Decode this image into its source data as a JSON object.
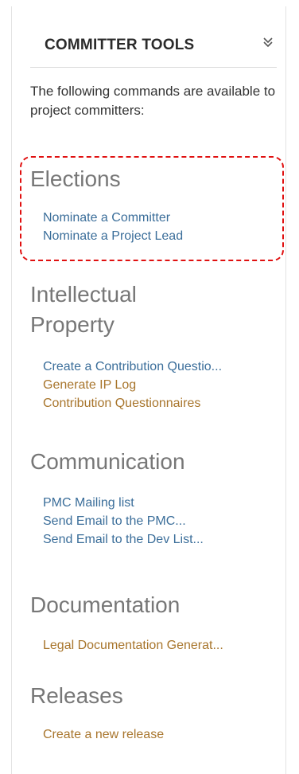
{
  "header": {
    "title": "COMMITTER TOOLS",
    "collapse_icon": "double-chevron-down-icon"
  },
  "intro": {
    "text": "The following commands are available to project committers:"
  },
  "sections": [
    {
      "title": "Elections",
      "links": [
        {
          "label": "Nominate a Committer",
          "color": "#3b6e9a"
        },
        {
          "label": "Nominate a Project Lead",
          "color": "#3b6e9a"
        }
      ]
    },
    {
      "title_lines": [
        "Intellectual",
        "Property"
      ],
      "links": [
        {
          "label": "Create a Contribution Questio...",
          "color": "#3b6e9a"
        },
        {
          "label": "Generate IP Log",
          "color": "#a8752c"
        },
        {
          "label": "Contribution Questionnaires",
          "color": "#a8752c"
        }
      ]
    },
    {
      "title": "Communication",
      "links": [
        {
          "label": "PMC Mailing list",
          "color": "#3b6e9a"
        },
        {
          "label": "Send Email to the PMC...",
          "color": "#3b6e9a"
        },
        {
          "label": "Send Email to the Dev List...",
          "color": "#3b6e9a"
        }
      ]
    },
    {
      "title": "Documentation",
      "links": [
        {
          "label": "Legal Documentation Generat...",
          "color": "#a8752c"
        }
      ]
    },
    {
      "title": "Releases",
      "links": [
        {
          "label": "Create a new release",
          "color": "#a8752c"
        }
      ]
    }
  ],
  "colors": {
    "link_blue": "#3b6e9a",
    "link_orange": "#a8752c",
    "section_title": "#777777",
    "highlight_border": "#e01010"
  }
}
